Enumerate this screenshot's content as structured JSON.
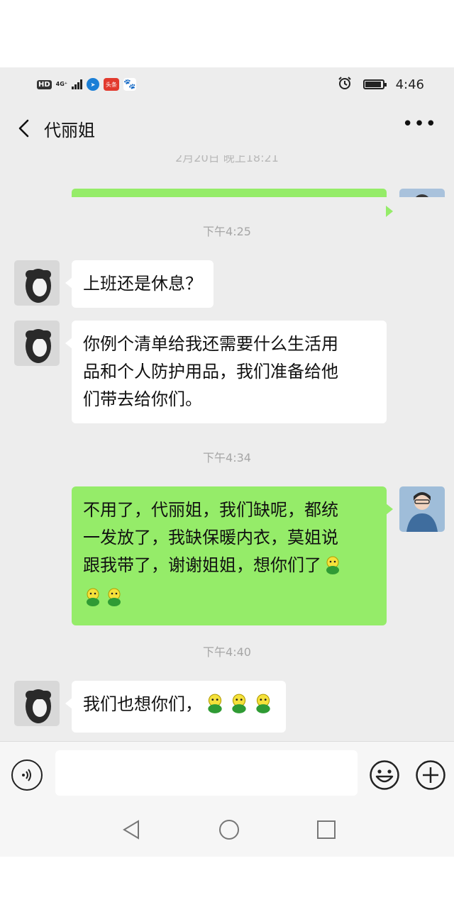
{
  "status_bar": {
    "network_hd": "HD",
    "network_type": "4G⁺",
    "app_badge_news": "头条",
    "time": "4:46"
  },
  "header": {
    "title": "代丽姐",
    "more_label": "•••"
  },
  "messages": {
    "earlier_timestamp": "2月20日 晚上18:21",
    "ts1": "下午4:25",
    "m1": "上班还是休息？",
    "m2_line1": "你例个清单给我还需要什么生活用",
    "m2_line2": "品和个人防护用品，我们准备给他",
    "m2_line3": "们带去给你们。",
    "ts2": "下午4:34",
    "m3_line1": "不用了，代丽姐，我们缺呢，都统",
    "m3_line2": "一发放了，我缺保暖内衣，莫姐说",
    "m3_line3": "跟我带了，谢谢姐姐，想你们了",
    "ts3": "下午4:40",
    "m4": "我们也想你们，"
  },
  "input": {
    "value": "",
    "placeholder": ""
  },
  "colors": {
    "outgoing_bubble": "#95ec69",
    "incoming_bubble": "#ffffff",
    "background": "#ededed",
    "timestamp": "#a6a6a6"
  },
  "icons": {
    "back": "chevron-left-icon",
    "more": "more-dots-icon",
    "voice": "voice-icon",
    "emoji": "emoji-face-icon",
    "plus": "plus-circle-icon",
    "nav_back": "triangle-back-icon",
    "nav_home": "circle-home-icon",
    "nav_recent": "square-recent-icon"
  }
}
